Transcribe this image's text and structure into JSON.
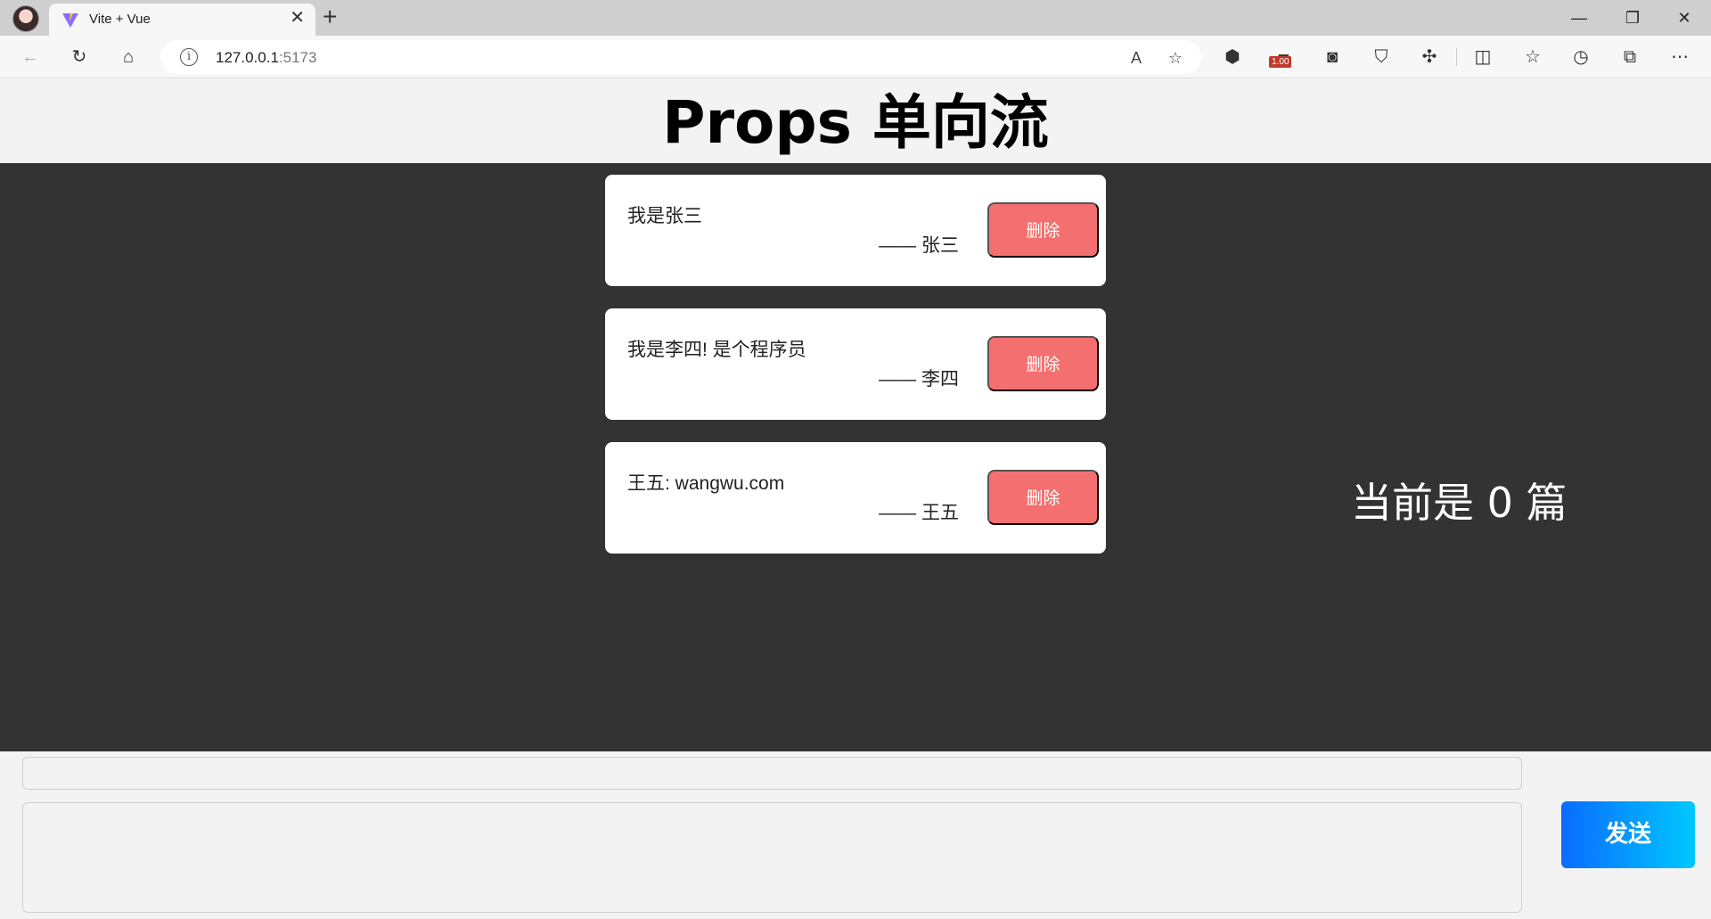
{
  "browser": {
    "tab_title": "Vite + Vue",
    "url_host": "127.0.0.1",
    "url_port": ":5173",
    "extension_badge": "1.00"
  },
  "page": {
    "title": "Props 单向流",
    "count_text": "当前是 0 篇",
    "send_label": "发送",
    "title_input_value": "",
    "content_input_value": ""
  },
  "cards": [
    {
      "content": "我是张三",
      "author": "—— 张三",
      "delete_label": "删除"
    },
    {
      "content": "我是李四! 是个程序员",
      "author": "—— 李四",
      "delete_label": "删除"
    },
    {
      "content": "王五: wangwu.com",
      "author": "—— 王五",
      "delete_label": "删除"
    }
  ],
  "colors": {
    "dark_bg": "#333333",
    "delete_button": "#f47070",
    "send_gradient_start": "#0a6bff",
    "send_gradient_end": "#00c8ff"
  }
}
